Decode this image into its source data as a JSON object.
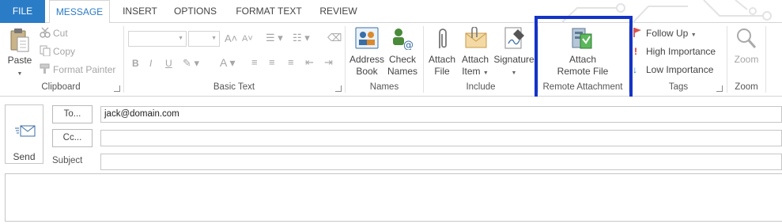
{
  "tabs": [
    {
      "label": "FILE"
    },
    {
      "label": "MESSAGE"
    },
    {
      "label": "INSERT"
    },
    {
      "label": "OPTIONS"
    },
    {
      "label": "FORMAT TEXT"
    },
    {
      "label": "REVIEW"
    }
  ],
  "clipboard": {
    "paste": "Paste",
    "cut": "Cut",
    "copy": "Copy",
    "format_painter": "Format Painter",
    "label": "Clipboard"
  },
  "basic_text": {
    "label": "Basic Text"
  },
  "names": {
    "address_book_1": "Address",
    "address_book_2": "Book",
    "check_names_1": "Check",
    "check_names_2": "Names",
    "label": "Names"
  },
  "include": {
    "attach_file_1": "Attach",
    "attach_file_2": "File",
    "attach_item_1": "Attach",
    "attach_item_2": "Item",
    "signature": "Signature",
    "label": "Include"
  },
  "remote": {
    "attach_1": "Attach",
    "attach_2": "Remote File",
    "label": "Remote Attachment"
  },
  "tags": {
    "follow_up": "Follow Up",
    "high": "High Importance",
    "low": "Low Importance",
    "label": "Tags"
  },
  "zoom": {
    "button": "Zoom",
    "label": "Zoom"
  },
  "compose": {
    "send": "Send",
    "to_button": "To...",
    "cc_button": "Cc...",
    "subject_label": "Subject",
    "to_value": "jack@domain.com",
    "cc_value": "",
    "subject_value": ""
  },
  "colors": {
    "accent": "#2b7cc6",
    "highlight_border": "#1434c8"
  }
}
